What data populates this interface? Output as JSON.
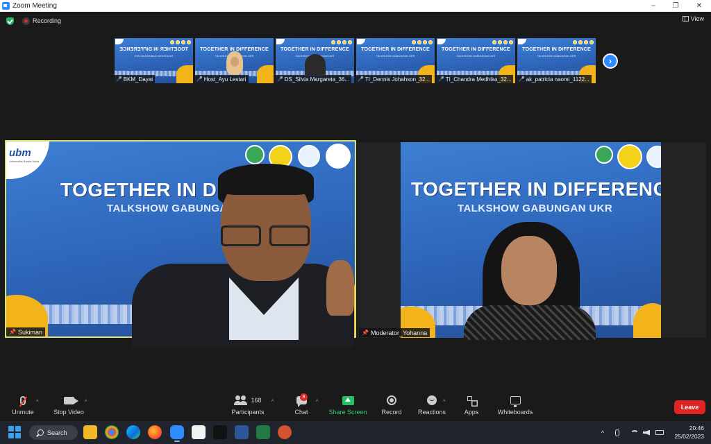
{
  "window": {
    "title": "Zoom Meeting",
    "minimize": "–",
    "restore": "❐",
    "close": "✕"
  },
  "meeting": {
    "recording_label": "Recording",
    "view_label": "View"
  },
  "thumbnails": [
    {
      "name": "BKM_Dayat",
      "banner_title": "TOGETHER IN DIFFERENCE",
      "banner_sub": "TALKSHOW GABUNGAN UKR",
      "mirrored": true,
      "muted": true
    },
    {
      "name": "Host_Ayu Lestari",
      "banner_title": "TOGETHER IN DIFFERENCE",
      "banner_sub": "TALKSHOW GABUNGAN UKR",
      "mirrored": false,
      "muted": true
    },
    {
      "name": "DS_Silvia Margareta_36...",
      "banner_title": "TOGETHER IN DIFFERENCE",
      "banner_sub": "TALKSHOW GABUNGAN UKR",
      "mirrored": false,
      "muted": true
    },
    {
      "name": "TI_Dennis Johahson_32...",
      "banner_title": "TOGETHER IN DIFFERENCE",
      "banner_sub": "TALKSHOW GABUNGAN UKR",
      "mirrored": false,
      "muted": true
    },
    {
      "name": "TI_Chandra Medhika_32...",
      "banner_title": "TOGETHER IN DIFFERENCE",
      "banner_sub": "TALKSHOW GABUNGAN UKR",
      "mirrored": false,
      "muted": true
    },
    {
      "name": "ak_patricia naomi_1122...",
      "banner_title": "TOGETHER IN DIFFERENCE",
      "banner_sub": "TALKSHOW GABUNGAN UKR",
      "mirrored": false,
      "muted": true
    }
  ],
  "next_page_glyph": "›",
  "speaker_tile": {
    "name": "Sukiman",
    "banner_title": "TOGETHER IN DIFFE",
    "banner_sub": "TALKSHOW GABUNGAN",
    "logo_text": "ubm",
    "logo_small": "Universitas Bunda Mulia"
  },
  "moderator_tile": {
    "name": "Moderator_Yohanna",
    "banner_title": "TOGETHER IN DIFFERENCE",
    "banner_sub": "TALKSHOW GABUNGAN UKR"
  },
  "toolbar": {
    "unmute": "Unmute",
    "stop_video": "Stop Video",
    "participants": "Participants",
    "participants_count": "168",
    "chat": "Chat",
    "chat_badge": "8",
    "share_screen": "Share Screen",
    "record": "Record",
    "reactions": "Reactions",
    "apps": "Apps",
    "whiteboards": "Whiteboards",
    "leave": "Leave",
    "caret": "^"
  },
  "taskbar": {
    "search_label": "Search",
    "time": "20:46",
    "date": "25/02/2023",
    "tray_chevron": "^"
  },
  "colors": {
    "accent": "#2d8cff",
    "leave": "#e02424",
    "share_green": "#23c063",
    "active_speaker_border": "#d6e37a",
    "banner_blue": "#2f6fc7",
    "banner_yellow": "#f2b31b"
  }
}
